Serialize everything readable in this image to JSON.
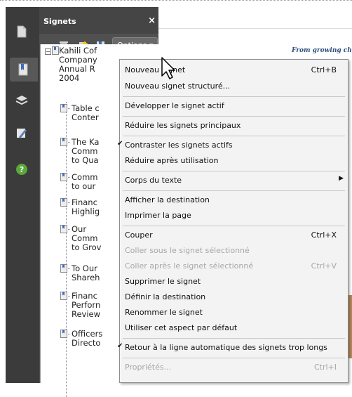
{
  "panel": {
    "title": "Signets",
    "close": "×",
    "options_label": "Options ▾"
  },
  "tree": {
    "root": "Kahili Cof\nCompany\nAnnual R\n2004",
    "items": [
      "Table c\nConter",
      "The Ka\nComm\nto Qua",
      "Comm\nto our",
      "Financ\nHighlig",
      "Our\nComm\nto Grov",
      "To Our\nShareh",
      "Financ\nPerforn\nReview",
      "Officers\nDirecto"
    ]
  },
  "document": {
    "headline": "From growing che"
  },
  "menu": {
    "items": [
      {
        "label": "Nouveau signet",
        "shortcut": "Ctrl+B",
        "enabled": true
      },
      {
        "label": "Nouveau signet structuré...",
        "shortcut": "",
        "enabled": true
      },
      {
        "label": "Développer le signet actif",
        "shortcut": "",
        "enabled": true
      },
      {
        "label": "Réduire les signets principaux",
        "shortcut": "",
        "enabled": true
      },
      {
        "label": "Contraster les signets actifs",
        "shortcut": "",
        "enabled": true,
        "checked": true
      },
      {
        "label": "Réduire après utilisation",
        "shortcut": "",
        "enabled": true
      },
      {
        "label": "Corps du texte",
        "shortcut": "",
        "enabled": true,
        "submenu": true
      },
      {
        "label": "Afficher la destination",
        "shortcut": "",
        "enabled": true
      },
      {
        "label": "Imprimer la page",
        "shortcut": "",
        "enabled": true
      },
      {
        "label": "Couper",
        "shortcut": "Ctrl+X",
        "enabled": true
      },
      {
        "label": "Coller sous le signet sélectionné",
        "shortcut": "",
        "enabled": false
      },
      {
        "label": "Coller après le signet sélectionné",
        "shortcut": "Ctrl+V",
        "enabled": false
      },
      {
        "label": "Supprimer le signet",
        "shortcut": "",
        "enabled": true
      },
      {
        "label": "Définir la destination",
        "shortcut": "",
        "enabled": true
      },
      {
        "label": "Renommer le signet",
        "shortcut": "",
        "enabled": true
      },
      {
        "label": "Utiliser cet aspect par défaut",
        "shortcut": "",
        "enabled": true
      },
      {
        "label": "Retour à la ligne automatique des signets trop longs",
        "shortcut": "",
        "enabled": true,
        "checked": true
      },
      {
        "label": "Propriétés...",
        "shortcut": "Ctrl+I",
        "enabled": false
      }
    ]
  },
  "colors": {
    "toolbar_bg": "#3b3b3b",
    "panel_bg": "#505050",
    "menu_bg": "#f3f3f3",
    "disabled_text": "#a7a7a7"
  }
}
